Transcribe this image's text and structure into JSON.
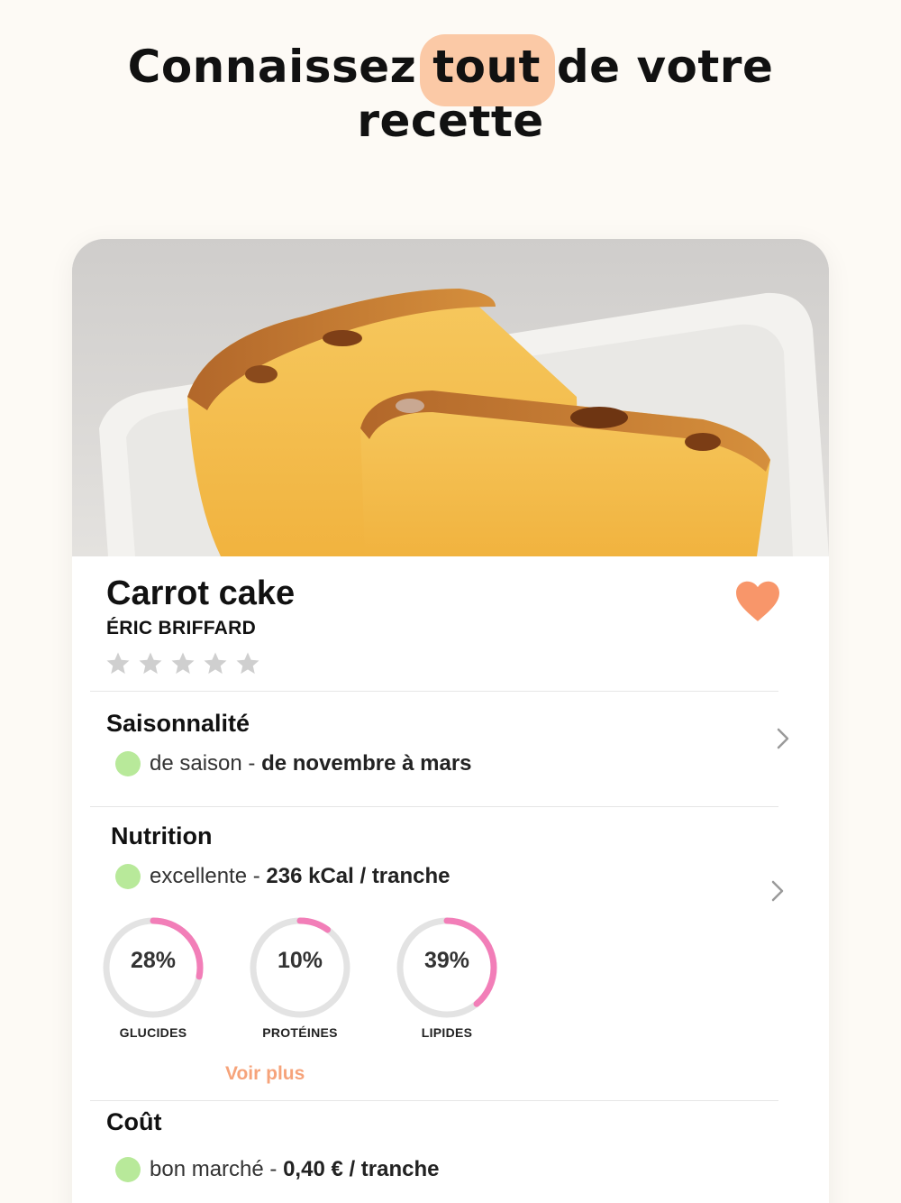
{
  "headline": {
    "before": "Connaissez ",
    "highlight": "tout",
    "after": " de votre",
    "line2": "recette"
  },
  "colors": {
    "background": "#fdfaf5",
    "highlight": "#fbc9a6",
    "heart": "#f8966a",
    "status_dot": "#b8e99a",
    "gauge_arc": "#f27eb8",
    "gauge_track": "#e3e3e3",
    "link": "#f6a37a"
  },
  "recipe": {
    "title": "Carrot cake",
    "author": "ÉRIC BRIFFARD",
    "rating": 0,
    "max_rating": 5,
    "favorite": true
  },
  "seasonality": {
    "title": "Saisonnalité",
    "status": "de saison",
    "separator": " - ",
    "detail": "de novembre à mars"
  },
  "nutrition": {
    "title": "Nutrition",
    "status": "excellente",
    "separator": " - ",
    "detail": "236 kCal / tranche",
    "macros": [
      {
        "label": "GLUCIDES",
        "value": "28%",
        "fraction": 0.28
      },
      {
        "label": "PROTÉINES",
        "value": "10%",
        "fraction": 0.1
      },
      {
        "label": "LIPIDES",
        "value": "39%",
        "fraction": 0.39
      }
    ],
    "more_label": "Voir plus"
  },
  "cost": {
    "title": "Coût",
    "status": "bon marché",
    "separator": " - ",
    "detail": "0,40 € / tranche"
  }
}
